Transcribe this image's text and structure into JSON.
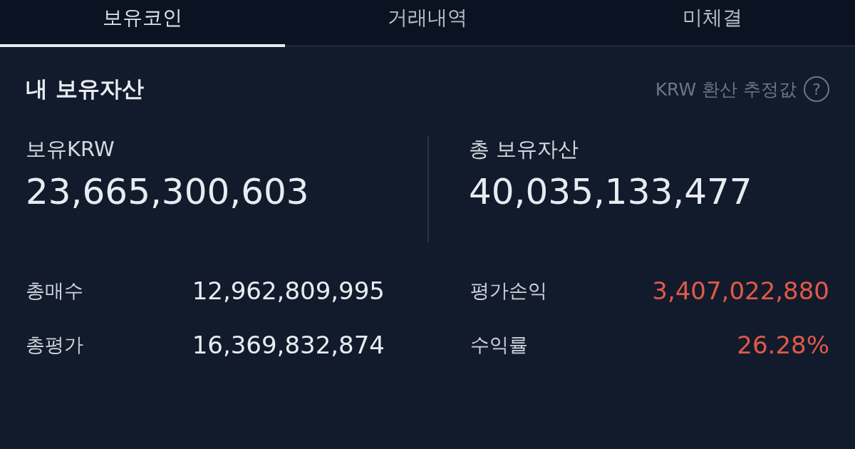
{
  "tabs": [
    {
      "label": "보유코인",
      "selected": true
    },
    {
      "label": "거래내역",
      "selected": false
    },
    {
      "label": "미체결",
      "selected": false
    }
  ],
  "section": {
    "title": "내 보유자산",
    "note": "KRW 환산 추정값",
    "help_icon": "?"
  },
  "summary": [
    {
      "label": "보유KRW",
      "value": "23,665,300,603"
    },
    {
      "label": "총 보유자산",
      "value": "40,035,133,477"
    }
  ],
  "details": [
    [
      {
        "label": "총매수",
        "value": "12,962,809,995"
      },
      {
        "label": "평가손익",
        "value": "3,407,022,880",
        "color": "#e0594a"
      }
    ],
    [
      {
        "label": "총평가",
        "value": "16,369,832,874"
      },
      {
        "label": "수익률",
        "value": "26.28%",
        "color": "#e0594a"
      }
    ]
  ]
}
